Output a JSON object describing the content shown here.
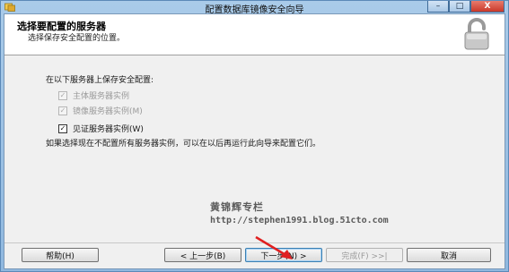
{
  "window": {
    "title": "配置数据库镜像安全向导",
    "minimize": "–",
    "maximize": "□",
    "close": "X"
  },
  "header": {
    "title": "选择要配置的服务器",
    "subtitle": "选择保存安全配置的位置。"
  },
  "body": {
    "intro": "在以下服务器上保存安全配置:",
    "checkboxes": [
      {
        "label": "主体服务器实例",
        "checked": true,
        "enabled": false
      },
      {
        "label": "镜像服务器实例(M)",
        "checked": true,
        "enabled": false
      },
      {
        "label": "见证服务器实例(W)",
        "checked": true,
        "enabled": true
      }
    ],
    "note": "如果选择现在不配置所有服务器实例，可以在以后再运行此向导来配置它们。"
  },
  "watermark": {
    "name": "黄锦辉专栏",
    "url": "http://stephen1991.blog.51cto.com"
  },
  "buttons": {
    "help": "帮助(H)",
    "back": "< 上一步(B)",
    "next": "下一步(N) >",
    "finish": "完成(F) >>|",
    "cancel": "取消"
  },
  "colors": {
    "annotation_arrow": "#e02020",
    "title_bar": "#a9cbe9"
  }
}
